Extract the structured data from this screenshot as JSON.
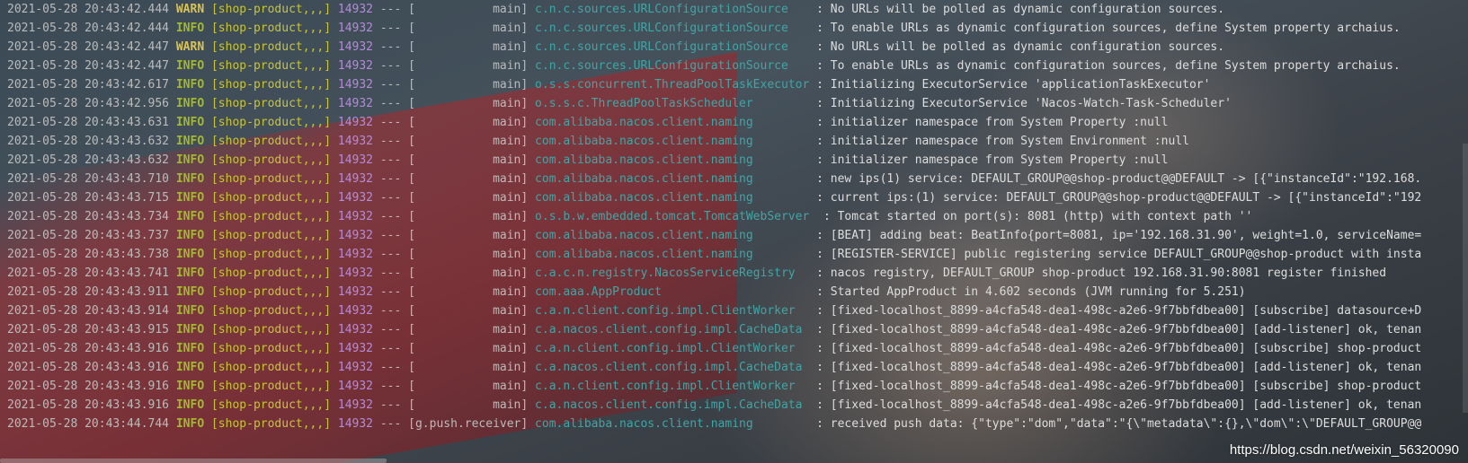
{
  "colors": {
    "timestamp": "#bbbbbb",
    "info": "#a3b830",
    "warn": "#d8c35a",
    "service": "#c7c43a",
    "pid": "#b58bd9",
    "logger": "#3fa6a6",
    "message": "#dddddd"
  },
  "watermark": "https://blog.csdn.net/weixin_56320090",
  "lines": [
    {
      "ts": "2021-05-28 20:43:42.444",
      "level": "WARN",
      "svc": "[shop-product,,,]",
      "pid": "14932",
      "sep": "---",
      "thread": "[           main]",
      "logger": "c.n.c.sources.URLConfigurationSource   ",
      "msg": ": No URLs will be polled as dynamic configuration sources."
    },
    {
      "ts": "2021-05-28 20:43:42.444",
      "level": "INFO",
      "svc": "[shop-product,,,]",
      "pid": "14932",
      "sep": "---",
      "thread": "[           main]",
      "logger": "c.n.c.sources.URLConfigurationSource   ",
      "msg": ": To enable URLs as dynamic configuration sources, define System property archaius."
    },
    {
      "ts": "2021-05-28 20:43:42.447",
      "level": "WARN",
      "svc": "[shop-product,,,]",
      "pid": "14932",
      "sep": "---",
      "thread": "[           main]",
      "logger": "c.n.c.sources.URLConfigurationSource   ",
      "msg": ": No URLs will be polled as dynamic configuration sources."
    },
    {
      "ts": "2021-05-28 20:43:42.447",
      "level": "INFO",
      "svc": "[shop-product,,,]",
      "pid": "14932",
      "sep": "---",
      "thread": "[           main]",
      "logger": "c.n.c.sources.URLConfigurationSource   ",
      "msg": ": To enable URLs as dynamic configuration sources, define System property archaius."
    },
    {
      "ts": "2021-05-28 20:43:42.617",
      "level": "INFO",
      "svc": "[shop-product,,,]",
      "pid": "14932",
      "sep": "---",
      "thread": "[           main]",
      "logger": "o.s.s.concurrent.ThreadPoolTaskExecutor",
      "msg": ": Initializing ExecutorService 'applicationTaskExecutor'"
    },
    {
      "ts": "2021-05-28 20:43:42.956",
      "level": "INFO",
      "svc": "[shop-product,,,]",
      "pid": "14932",
      "sep": "---",
      "thread": "[           main]",
      "logger": "o.s.s.c.ThreadPoolTaskScheduler        ",
      "msg": ": Initializing ExecutorService 'Nacos-Watch-Task-Scheduler'"
    },
    {
      "ts": "2021-05-28 20:43:43.631",
      "level": "INFO",
      "svc": "[shop-product,,,]",
      "pid": "14932",
      "sep": "---",
      "thread": "[           main]",
      "logger": "com.alibaba.nacos.client.naming        ",
      "msg": ": initializer namespace from System Property :null"
    },
    {
      "ts": "2021-05-28 20:43:43.632",
      "level": "INFO",
      "svc": "[shop-product,,,]",
      "pid": "14932",
      "sep": "---",
      "thread": "[           main]",
      "logger": "com.alibaba.nacos.client.naming        ",
      "msg": ": initializer namespace from System Environment :null"
    },
    {
      "ts": "2021-05-28 20:43:43.632",
      "level": "INFO",
      "svc": "[shop-product,,,]",
      "pid": "14932",
      "sep": "---",
      "thread": "[           main]",
      "logger": "com.alibaba.nacos.client.naming        ",
      "msg": ": initializer namespace from System Property :null"
    },
    {
      "ts": "2021-05-28 20:43:43.710",
      "level": "INFO",
      "svc": "[shop-product,,,]",
      "pid": "14932",
      "sep": "---",
      "thread": "[           main]",
      "logger": "com.alibaba.nacos.client.naming        ",
      "msg": ": new ips(1) service: DEFAULT_GROUP@@shop-product@@DEFAULT -> [{\"instanceId\":\"192.168."
    },
    {
      "ts": "2021-05-28 20:43:43.715",
      "level": "INFO",
      "svc": "[shop-product,,,]",
      "pid": "14932",
      "sep": "---",
      "thread": "[           main]",
      "logger": "com.alibaba.nacos.client.naming        ",
      "msg": ": current ips:(1) service: DEFAULT_GROUP@@shop-product@@DEFAULT -> [{\"instanceId\":\"192"
    },
    {
      "ts": "2021-05-28 20:43:43.734",
      "level": "INFO",
      "svc": "[shop-product,,,]",
      "pid": "14932",
      "sep": "---",
      "thread": "[           main]",
      "logger": "o.s.b.w.embedded.tomcat.TomcatWebServer ",
      "msg": ": Tomcat started on port(s): 8081 (http) with context path ''"
    },
    {
      "ts": "2021-05-28 20:43:43.737",
      "level": "INFO",
      "svc": "[shop-product,,,]",
      "pid": "14932",
      "sep": "---",
      "thread": "[           main]",
      "logger": "com.alibaba.nacos.client.naming        ",
      "msg": ": [BEAT] adding beat: BeatInfo{port=8081, ip='192.168.31.90', weight=1.0, serviceName="
    },
    {
      "ts": "2021-05-28 20:43:43.738",
      "level": "INFO",
      "svc": "[shop-product,,,]",
      "pid": "14932",
      "sep": "---",
      "thread": "[           main]",
      "logger": "com.alibaba.nacos.client.naming        ",
      "msg": ": [REGISTER-SERVICE] public registering service DEFAULT_GROUP@@shop-product with insta"
    },
    {
      "ts": "2021-05-28 20:43:43.741",
      "level": "INFO",
      "svc": "[shop-product,,,]",
      "pid": "14932",
      "sep": "---",
      "thread": "[           main]",
      "logger": "c.a.c.n.registry.NacosServiceRegistry  ",
      "msg": ": nacos registry, DEFAULT_GROUP shop-product 192.168.31.90:8081 register finished"
    },
    {
      "ts": "2021-05-28 20:43:43.911",
      "level": "INFO",
      "svc": "[shop-product,,,]",
      "pid": "14932",
      "sep": "---",
      "thread": "[           main]",
      "logger": "com.aaa.AppProduct                     ",
      "msg": ": Started AppProduct in 4.602 seconds (JVM running for 5.251)"
    },
    {
      "ts": "2021-05-28 20:43:43.914",
      "level": "INFO",
      "svc": "[shop-product,,,]",
      "pid": "14932",
      "sep": "---",
      "thread": "[           main]",
      "logger": "c.a.n.client.config.impl.ClientWorker  ",
      "msg": ": [fixed-localhost_8899-a4cfa548-dea1-498c-a2e6-9f7bbfdbea00] [subscribe] datasource+D"
    },
    {
      "ts": "2021-05-28 20:43:43.915",
      "level": "INFO",
      "svc": "[shop-product,,,]",
      "pid": "14932",
      "sep": "---",
      "thread": "[           main]",
      "logger": "c.a.nacos.client.config.impl.CacheData ",
      "msg": ": [fixed-localhost_8899-a4cfa548-dea1-498c-a2e6-9f7bbfdbea00] [add-listener] ok, tenan"
    },
    {
      "ts": "2021-05-28 20:43:43.916",
      "level": "INFO",
      "svc": "[shop-product,,,]",
      "pid": "14932",
      "sep": "---",
      "thread": "[           main]",
      "logger": "c.a.n.client.config.impl.ClientWorker  ",
      "msg": ": [fixed-localhost_8899-a4cfa548-dea1-498c-a2e6-9f7bbfdbea00] [subscribe] shop-product"
    },
    {
      "ts": "2021-05-28 20:43:43.916",
      "level": "INFO",
      "svc": "[shop-product,,,]",
      "pid": "14932",
      "sep": "---",
      "thread": "[           main]",
      "logger": "c.a.nacos.client.config.impl.CacheData ",
      "msg": ": [fixed-localhost_8899-a4cfa548-dea1-498c-a2e6-9f7bbfdbea00] [add-listener] ok, tenan"
    },
    {
      "ts": "2021-05-28 20:43:43.916",
      "level": "INFO",
      "svc": "[shop-product,,,]",
      "pid": "14932",
      "sep": "---",
      "thread": "[           main]",
      "logger": "c.a.n.client.config.impl.ClientWorker  ",
      "msg": ": [fixed-localhost_8899-a4cfa548-dea1-498c-a2e6-9f7bbfdbea00] [subscribe] shop-product"
    },
    {
      "ts": "2021-05-28 20:43:43.916",
      "level": "INFO",
      "svc": "[shop-product,,,]",
      "pid": "14932",
      "sep": "---",
      "thread": "[           main]",
      "logger": "c.a.nacos.client.config.impl.CacheData ",
      "msg": ": [fixed-localhost_8899-a4cfa548-dea1-498c-a2e6-9f7bbfdbea00] [add-listener] ok, tenan"
    },
    {
      "ts": "2021-05-28 20:43:44.744",
      "level": "INFO",
      "svc": "[shop-product,,,]",
      "pid": "14932",
      "sep": "---",
      "thread": "[g.push.receiver]",
      "logger": "com.alibaba.nacos.client.naming        ",
      "msg": ": received push data: {\"type\":\"dom\",\"data\":\"{\\\"metadata\\\":{},\\\"dom\\\":\\\"DEFAULT_GROUP@@"
    }
  ]
}
